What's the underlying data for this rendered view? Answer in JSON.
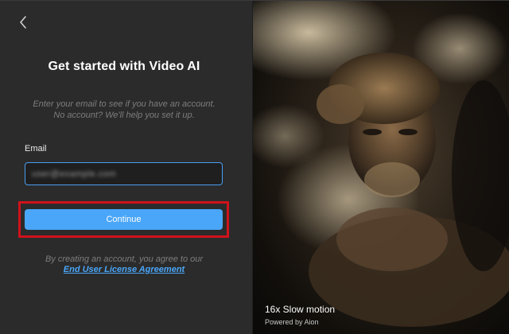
{
  "signup": {
    "title": "Get started with Video AI",
    "subtitle_line1": "Enter your email to see if you have an account.",
    "subtitle_line2": "No account? We'll help you set it up.",
    "email_label": "Email",
    "email_value": "user@example.com",
    "continue_label": "Continue",
    "agree_text": "By creating an account, you agree to our",
    "eula_link": "End User License Agreement"
  },
  "preview": {
    "caption_title": "16x Slow motion",
    "caption_subtitle": "Powered by Aion"
  },
  "icons": {
    "back": "chevron-left-icon"
  },
  "colors": {
    "accent": "#4aa6f8",
    "input_focus": "#4a9df0",
    "highlight": "#d0121b",
    "panel_bg": "#2b2b2b"
  }
}
